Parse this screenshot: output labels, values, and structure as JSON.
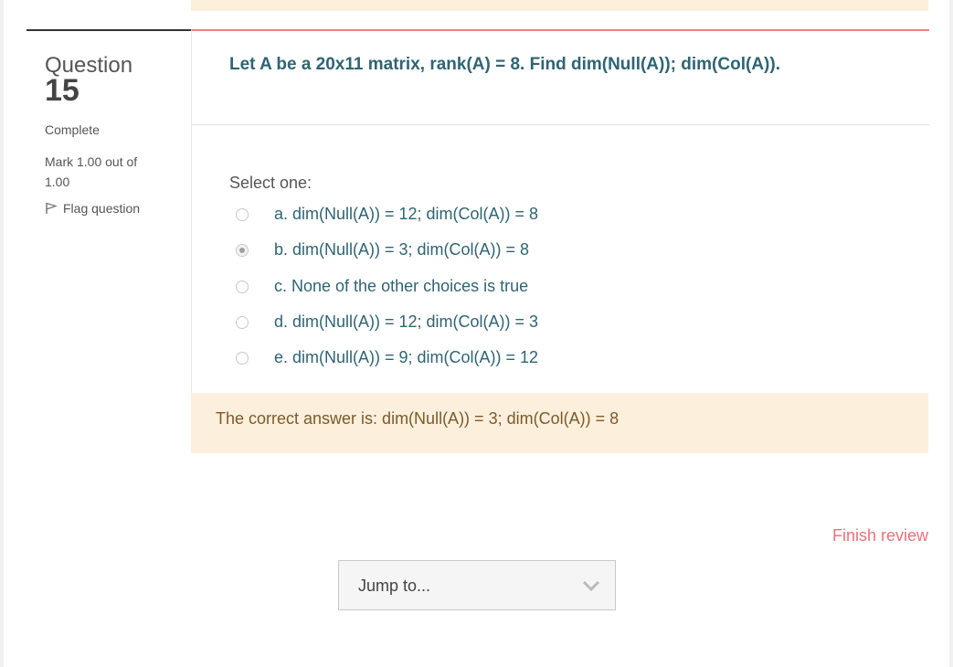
{
  "question_info": {
    "label": "Question",
    "number": "15",
    "state": "Complete",
    "grade": "Mark 1.00 out of 1.00",
    "flag_label": "Flag question"
  },
  "question": {
    "text": "Let A be a 20x11 matrix, rank(A) = 8. Find dim(Null(A)); dim(Col(A)).",
    "prompt": "Select one:",
    "options": [
      {
        "label": "a. dim(Null(A)) = 12; dim(Col(A)) = 8",
        "selected": false
      },
      {
        "label": "b. dim(Null(A)) = 3; dim(Col(A)) = 8",
        "selected": true
      },
      {
        "label": "c. None of the other choices is true",
        "selected": false
      },
      {
        "label": "d. dim(Null(A)) = 12; dim(Col(A)) = 3",
        "selected": false
      },
      {
        "label": "e. dim(Null(A)) = 9; dim(Col(A)) = 12",
        "selected": false
      }
    ]
  },
  "feedback": {
    "text": "The correct answer is: dim(Null(A)) = 3; dim(Col(A)) = 8"
  },
  "navigation": {
    "finish_review": "Finish review",
    "jump_to": "Jump to..."
  },
  "colors": {
    "accent": "#ef6f7b",
    "question_text": "#2f6473",
    "feedback_bg": "#fcefdc"
  }
}
